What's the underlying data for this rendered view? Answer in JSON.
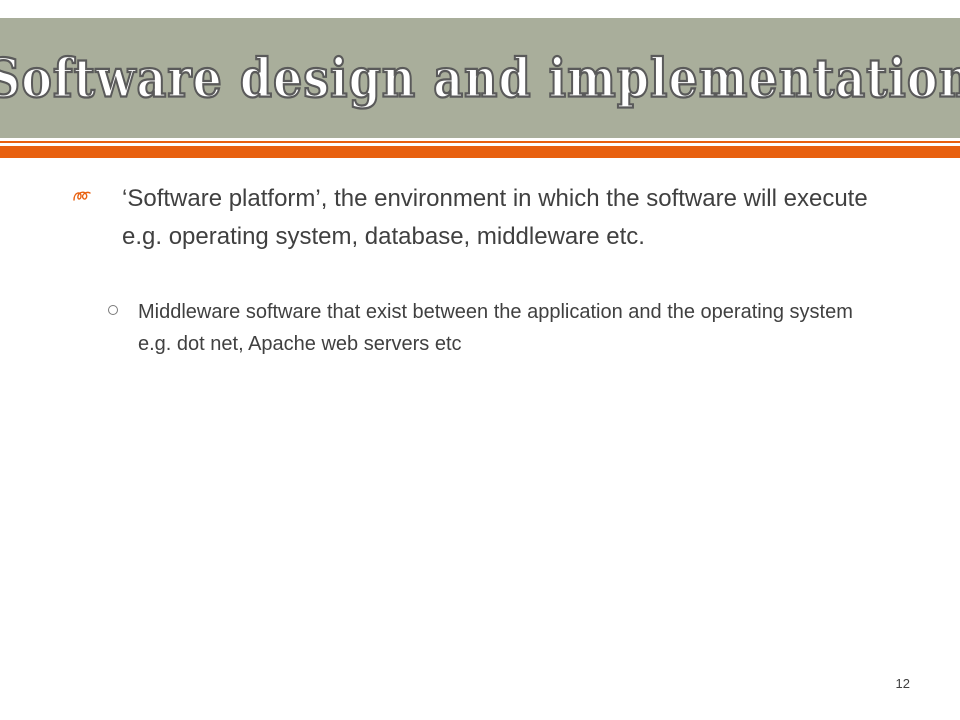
{
  "slide": {
    "title": "Software design and implementation",
    "bullets": [
      {
        "text": "‘Software platform’, the environment in which the software will execute e.g. operating system, database, middleware etc.",
        "sub_bullets": [
          {
            "text": "Middleware software that exist between the application and the operating system e.g. dot net, Apache web servers etc"
          }
        ]
      }
    ],
    "page_number": "12"
  },
  "icons": {
    "level1_bullet": "curl-bullet-icon",
    "level2_bullet": "hollow-circle-bullet-icon"
  },
  "colors": {
    "title_band": "#a9ae9b",
    "accent_orange": "#e8600f",
    "body_text": "#404040",
    "title_fill": "#ffffff",
    "title_outline": "#5a5a5a"
  }
}
